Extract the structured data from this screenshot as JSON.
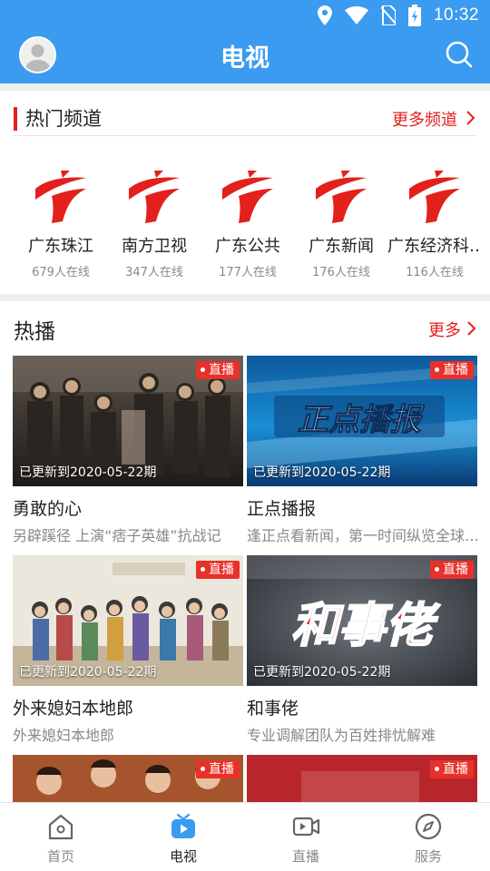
{
  "status_bar": {
    "time": "10:32"
  },
  "app_bar": {
    "title": "电视"
  },
  "hot_channels": {
    "title": "热门频道",
    "more_label": "更多频道",
    "items": [
      {
        "name": "广东珠江",
        "viewers": "679人在线"
      },
      {
        "name": "南方卫视",
        "viewers": "347人在线"
      },
      {
        "name": "广东公共",
        "viewers": "177人在线"
      },
      {
        "name": "广东新闻",
        "viewers": "176人在线"
      },
      {
        "name": "广东经济科…",
        "viewers": "116人在线"
      }
    ]
  },
  "hot_play": {
    "title": "热播",
    "more_label": "更多",
    "live_label": "直播",
    "items": [
      {
        "title": "勇敢的心",
        "subtitle": "另辟蹊径 上演“痞子英雄”抗战记",
        "updated": "已更新到2020-05-22期"
      },
      {
        "title": "正点播报",
        "subtitle": "逢正点看新闻，第一时间纵览全球…",
        "updated": "已更新到2020-05-22期",
        "thumb_text": "正点播报"
      },
      {
        "title": "外来媳妇本地郎",
        "subtitle": "外来媳妇本地郎",
        "updated": "已更新到2020-05-22期"
      },
      {
        "title": "和事佬",
        "subtitle": "专业调解团队为百姓排忧解难",
        "updated": "已更新到2020-05-22期",
        "thumb_text": "和事佬"
      },
      {
        "title": "",
        "subtitle": "",
        "updated": ""
      },
      {
        "title": "",
        "subtitle": "",
        "updated": ""
      }
    ]
  },
  "bottom_nav": {
    "items": [
      {
        "label": "首页",
        "icon": "home-icon"
      },
      {
        "label": "电视",
        "icon": "tv-icon",
        "active": true
      },
      {
        "label": "直播",
        "icon": "live-video-icon"
      },
      {
        "label": "服务",
        "icon": "compass-icon"
      }
    ]
  },
  "colors": {
    "primary": "#3a9bf0",
    "accent": "#e3201b",
    "live_badge": "#e8312a"
  }
}
